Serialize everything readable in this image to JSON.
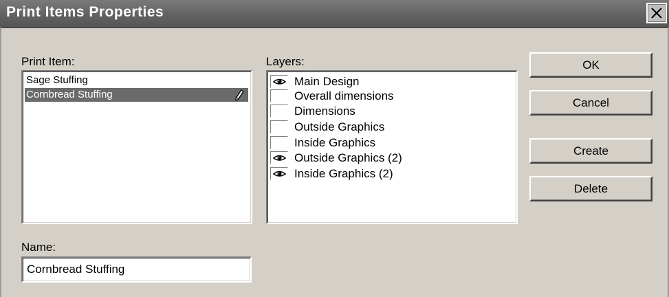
{
  "window": {
    "title": "Print Items Properties"
  },
  "print_items": {
    "label": "Print Item:",
    "items": [
      {
        "label": "Sage Stuffing",
        "selected": false
      },
      {
        "label": "Cornbread Stuffing",
        "selected": true
      }
    ],
    "editing_icon": "pencil-icon"
  },
  "layers": {
    "label": "Layers:",
    "items": [
      {
        "label": "Main Design",
        "visible": true
      },
      {
        "label": "Overall dimensions",
        "visible": false
      },
      {
        "label": "Dimensions",
        "visible": false
      },
      {
        "label": "Outside Graphics",
        "visible": false
      },
      {
        "label": "Inside Graphics",
        "visible": false
      },
      {
        "label": "Outside Graphics (2)",
        "visible": true
      },
      {
        "label": "Inside Graphics (2)",
        "visible": true
      }
    ],
    "visible_icon": "eye-icon"
  },
  "buttons": {
    "ok": "OK",
    "cancel": "Cancel",
    "create": "Create",
    "delete": "Delete"
  },
  "name": {
    "label": "Name:",
    "value": "Cornbread Stuffing"
  },
  "colors": {
    "title_bar": "#626262",
    "dialog_bg": "#d4d0c8",
    "selection": "#6a6a6a"
  }
}
